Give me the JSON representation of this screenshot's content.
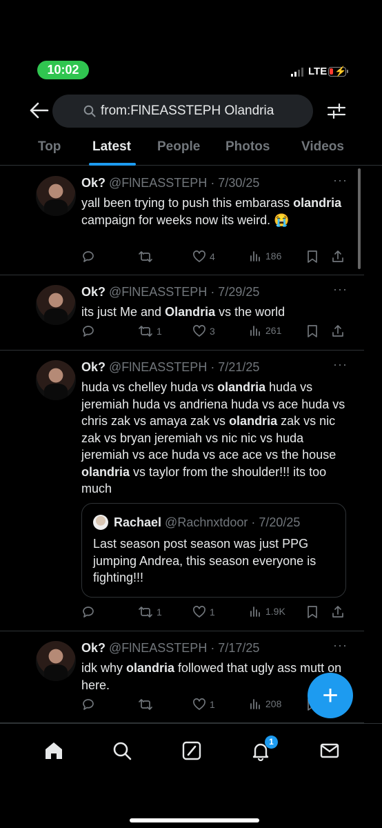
{
  "status_bar": {
    "time": "10:02",
    "network": "LTE",
    "battery_color": "#ff3b30"
  },
  "search": {
    "query": "from:FlNEASSTEPH Olandria"
  },
  "tabs": [
    {
      "label": "Top"
    },
    {
      "label": "Latest",
      "active": true
    },
    {
      "label": "People"
    },
    {
      "label": "Photos"
    },
    {
      "label": "Videos"
    }
  ],
  "tweets": [
    {
      "name": "Ok?",
      "meta": " @FlNEASSTEPH · 7/30/25",
      "text_parts": [
        "yall been trying to push this embarass ",
        "olandria",
        " campaign for weeks now its weird. 😭"
      ],
      "replies": "",
      "retweets": "",
      "likes": "4",
      "views": "186"
    },
    {
      "name": "Ok?",
      "meta": " @FlNEASSTEPH · 7/29/25",
      "text_parts": [
        "its just Me and ",
        "Olandria",
        " vs the world"
      ],
      "replies": "",
      "retweets": "1",
      "likes": "3",
      "views": "261"
    },
    {
      "name": "Ok?",
      "meta": " @FlNEASSTEPH · 7/21/25",
      "text_parts": [
        "huda vs chelley  huda vs ",
        "olandria",
        "  huda vs jeremiah  huda vs andriena huda vs ace huda vs chris  zak vs amaya  zak vs ",
        "olandria",
        " zak vs nic zak vs bryan jeremiah vs nic nic vs huda jeremiah vs ace huda vs ace ace vs the house ",
        "olandria",
        " vs taylor from the shoulder!!! its too much"
      ],
      "quote": {
        "name": "Rachael",
        "meta": "@Rachnxtdoor · 7/20/25",
        "text": "Last season post season was just PPG jumping Andrea, this season everyone is fighting!!!"
      },
      "replies": "",
      "retweets": "1",
      "likes": "1",
      "views": "1.9K"
    },
    {
      "name": "Ok?",
      "meta": " @FlNEASSTEPH · 7/17/25",
      "text_parts": [
        "idk why ",
        "olandria",
        " followed that ugly ass mutt on here."
      ],
      "replies": "",
      "retweets": "",
      "likes": "1",
      "views": "208"
    }
  ],
  "more_glyph": "···",
  "fab_label": "+",
  "bottom_nav": {
    "items": [
      "home-icon",
      "search-icon",
      "grok-icon",
      "notifications-icon",
      "messages-icon"
    ],
    "notifications_badge": "1"
  },
  "colors": {
    "accent": "#1d9bf0",
    "background": "#000000",
    "muted": "#71767b"
  }
}
